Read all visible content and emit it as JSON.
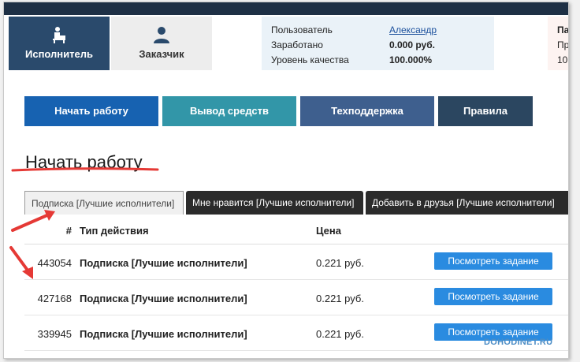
{
  "roles": {
    "executor": {
      "label": "Исполнитель",
      "icon": "worker-at-desk-icon"
    },
    "customer": {
      "label": "Заказчик",
      "icon": "user-icon"
    }
  },
  "stats": {
    "user_label": "Пользователь",
    "user_value": "Александр",
    "earned_label": "Заработано",
    "earned_value": "0.000 руб.",
    "quality_label": "Уровень качества",
    "quality_value": "100.000%"
  },
  "right_panel": {
    "line1": "Па",
    "line2": "Пр",
    "line3": "10"
  },
  "nav": {
    "start": "Начать работу",
    "withdraw": "Вывод средств",
    "support": "Техподдержка",
    "rules": "Правила"
  },
  "page_title": "Начать работу",
  "subtabs": [
    {
      "label": "Подписка [Лучшие исполнители]",
      "active": true
    },
    {
      "label": "Мне нравится [Лучшие исполнители]",
      "active": false
    },
    {
      "label": "Добавить в друзья [Лучшие исполнители]",
      "active": false
    }
  ],
  "table": {
    "headers": {
      "num": "#",
      "type": "Тип действия",
      "price": "Цена"
    },
    "rows": [
      {
        "id": "443054",
        "type": "Подписка [Лучшие исполнители]",
        "price": "0.221 руб.",
        "action": "Посмотреть задание"
      },
      {
        "id": "427168",
        "type": "Подписка [Лучшие исполнители]",
        "price": "0.221 руб.",
        "action": "Посмотреть задание"
      },
      {
        "id": "339945",
        "type": "Подписка [Лучшие исполнители]",
        "price": "0.221 руб.",
        "action": "Посмотреть задание"
      }
    ]
  },
  "watermark": "DOHODINET.RU",
  "colors": {
    "header_bar": "#1e3045",
    "nav_start": "#1762b1",
    "nav_withdraw": "#3296a8",
    "nav_support": "#3e5f8e",
    "nav_rules": "#2b4660",
    "view_button": "#2a8be0",
    "annotation": "#e53935"
  }
}
